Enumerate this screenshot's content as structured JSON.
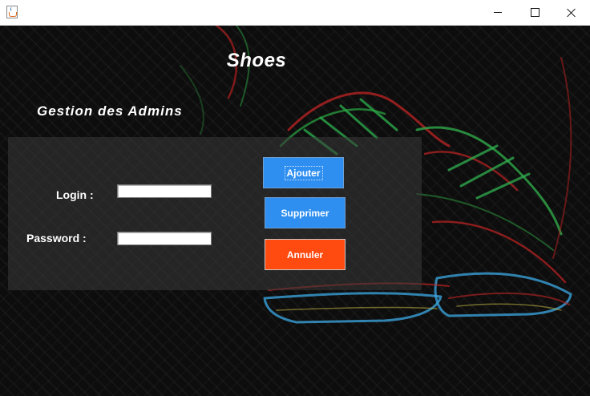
{
  "window": {
    "title": ""
  },
  "app": {
    "title": "Shoes"
  },
  "section": {
    "title": "Gestion des Admins"
  },
  "form": {
    "login_label": "Login :",
    "login_value": "",
    "password_label": "Password :",
    "password_value": ""
  },
  "buttons": {
    "add_label": "Ajouter",
    "delete_label": "Supprimer",
    "cancel_label": "Annuler"
  },
  "colors": {
    "primary_button": "#2e8ff0",
    "cancel_button": "#ff4a10",
    "text": "#ffffff",
    "background": "#0d0d0d"
  },
  "icons": [
    "java-app-icon",
    "minimize-icon",
    "maximize-icon",
    "close-icon"
  ]
}
